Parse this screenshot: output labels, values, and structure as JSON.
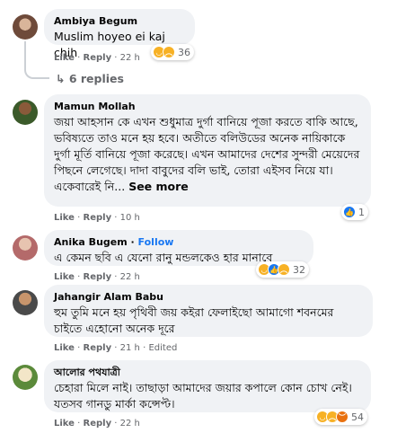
{
  "comments": [
    {
      "author": "Ambiya Begum",
      "text": "Muslim hoyeo ei kaj chih",
      "like": "Like",
      "reply": "Reply",
      "time": "22 h",
      "reaction_count": "36",
      "reactions": [
        "haha-icon",
        "sad-icon"
      ],
      "replies": "6 replies"
    },
    {
      "author": "Mamun Mollah",
      "text": "জয়া আহসান কে এখন শুধুমাত্র দুর্গা বানিয়ে পূজা করতে বাকি আছে, ভবিষ্যতে তাও মনে হয় হবে। অতীতে বলিউডের অনেক নায়িকাকে দুর্গা মূর্তি বানিয়ে পূজা করেছে। এখন আমাদের দেশের সুন্দরী মেয়েদের পিছনে লেগেছে। দাদা বাবুদের বলি ভাই, তোরা এইসব নিয়ে যা। একেবারেই নি...",
      "see_more": "See more",
      "like": "Like",
      "reply": "Reply",
      "time": "10 h",
      "reaction_count": "1",
      "reactions": [
        "like-icon"
      ]
    },
    {
      "author": "Anika Bugem",
      "follow": "Follow",
      "text": "এ কেমন ছবি এ যেনো রানু মন্ডলকেও হার মানাবে",
      "like": "Like",
      "reply": "Reply",
      "time": "22 h",
      "reaction_count": "32",
      "reactions": [
        "haha-icon",
        "like-icon",
        "sad-icon"
      ]
    },
    {
      "author": "Jahangir Alam Babu",
      "text": "হুম তুমি মনে হয় পৃথিবী জয় কইরা ফেলাইছো আমাগো শবনমের চাইতে এহোনো অনেক দূরে",
      "like": "Like",
      "reply": "Reply",
      "time": "21 h",
      "edited": "Edited"
    },
    {
      "author": "আলোর পথযাত্রী",
      "text": "চেহারা মিলে নাই। তাছাড়া আমাদের জয়ার কপালে কোন চোখ নেই। যতসব গানডু মার্কা কন্সেপ্ট।",
      "like": "Like",
      "reply": "Reply",
      "time": "22 h",
      "reaction_count": "54",
      "reactions": [
        "haha-icon",
        "sad-icon",
        "angry-icon"
      ]
    }
  ],
  "colors": {
    "bubble": "#f0f2f5",
    "meta": "#65676b",
    "link": "#1877f2"
  }
}
